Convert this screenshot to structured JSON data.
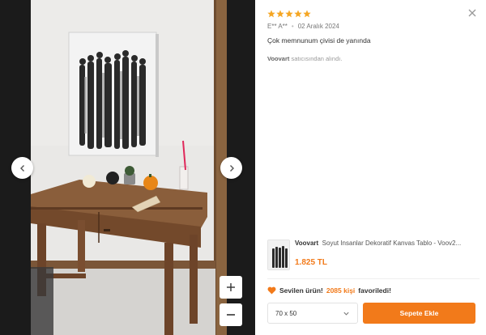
{
  "review": {
    "rating": 5,
    "author": "E** A**",
    "date": "02 Aralık 2024",
    "comment": "Çok memnunum çivisi de yanında",
    "seller_name": "Voovart",
    "seller_suffix": "satıcısından alındı."
  },
  "product": {
    "brand": "Voovart",
    "title": "Soyut Insanlar Dekoratif Kanvas Tablo - Voov2...",
    "price": "1.825 TL"
  },
  "favorites": {
    "prefix": "Sevilen ürün!",
    "count_text": "2085 kişi",
    "suffix": "favoriledi!"
  },
  "variant": {
    "selected": "70 x 50"
  },
  "actions": {
    "add_to_cart": "Sepete Ekle"
  },
  "icons": {
    "prev": "chevron-left-icon",
    "next": "chevron-right-icon",
    "zoom_in": "plus-icon",
    "zoom_out": "minus-icon",
    "close": "close-icon",
    "star": "star-icon",
    "heart": "heart-icon"
  },
  "colors": {
    "accent": "#f27a1a",
    "star": "#f5a623",
    "viewer_bg": "#1b1b1b"
  }
}
